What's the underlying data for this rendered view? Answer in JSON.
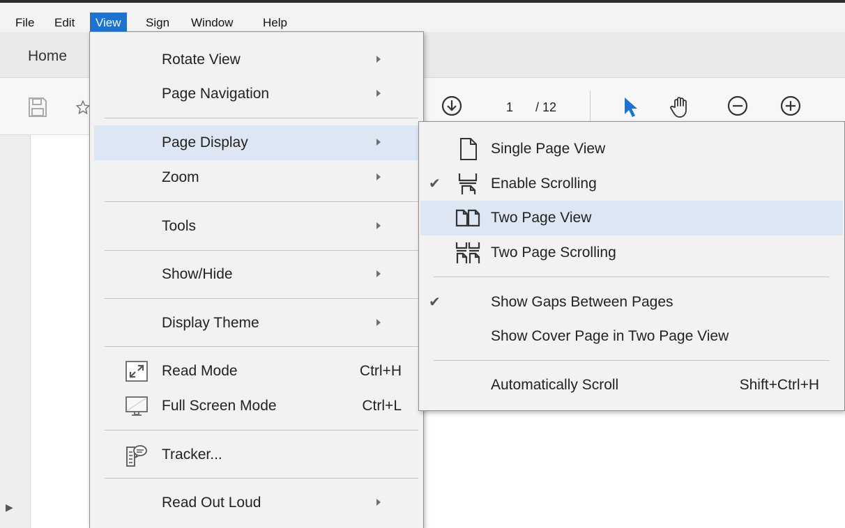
{
  "menubar": {
    "items": [
      {
        "label": "File"
      },
      {
        "label": "Edit"
      },
      {
        "label": "View"
      },
      {
        "label": "Sign"
      },
      {
        "label": "Window"
      },
      {
        "label": "Help"
      }
    ],
    "active": "View"
  },
  "tabs": {
    "home": "Home"
  },
  "toolbar": {
    "page_current": "1",
    "page_total": "/ 12"
  },
  "view_menu": {
    "items": [
      {
        "label": "Rotate View",
        "icon": null,
        "submenu": true
      },
      {
        "label": "Page Navigation",
        "icon": null,
        "submenu": true
      },
      {
        "label": "Page Display",
        "icon": null,
        "submenu": true,
        "highlighted": true
      },
      {
        "label": "Zoom",
        "icon": null,
        "submenu": true
      },
      {
        "label": "Tools",
        "icon": null,
        "submenu": true
      },
      {
        "label": "Show/Hide",
        "icon": null,
        "submenu": true
      },
      {
        "label": "Display Theme",
        "icon": null,
        "submenu": true
      },
      {
        "label": "Read Mode",
        "icon": "read-mode-icon",
        "shortcut": "Ctrl+H"
      },
      {
        "label": "Full Screen Mode",
        "icon": "full-screen-icon",
        "shortcut": "Ctrl+L"
      },
      {
        "label": "Tracker...",
        "icon": "tracker-icon"
      },
      {
        "label": "Read Out Loud",
        "icon": null,
        "submenu": true
      }
    ]
  },
  "page_display_menu": {
    "items": [
      {
        "label": "Single Page View",
        "icon": "single-page-icon",
        "checked": false
      },
      {
        "label": "Enable Scrolling",
        "icon": "scrolling-icon",
        "checked": true
      },
      {
        "label": "Two Page View",
        "icon": "two-page-icon",
        "checked": false,
        "highlighted": true
      },
      {
        "label": "Two Page Scrolling",
        "icon": "two-page-scrolling-icon",
        "checked": false
      },
      {
        "label": "Show Gaps Between Pages",
        "checked": true
      },
      {
        "label": "Show Cover Page in Two Page View",
        "checked": false
      },
      {
        "label": "Automatically Scroll",
        "shortcut": "Shift+Ctrl+H",
        "checked": false
      }
    ],
    "check_glyph": "✔"
  },
  "colors": {
    "accent": "#1c73d0",
    "highlight": "#dde7f3",
    "menu_bg": "#f2f2f2"
  }
}
